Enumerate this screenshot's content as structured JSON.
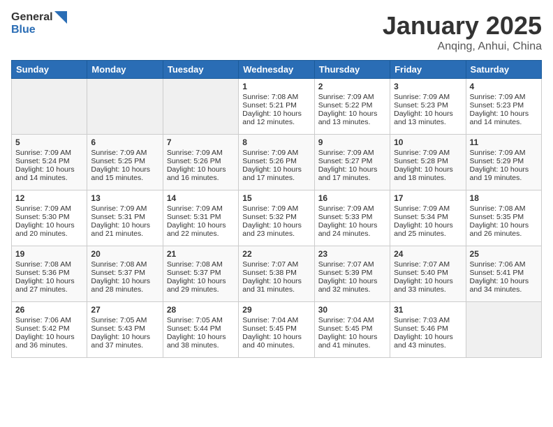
{
  "header": {
    "logo_general": "General",
    "logo_blue": "Blue",
    "month": "January 2025",
    "location": "Anqing, Anhui, China"
  },
  "days_of_week": [
    "Sunday",
    "Monday",
    "Tuesday",
    "Wednesday",
    "Thursday",
    "Friday",
    "Saturday"
  ],
  "weeks": [
    [
      {
        "day": "",
        "text": ""
      },
      {
        "day": "",
        "text": ""
      },
      {
        "day": "",
        "text": ""
      },
      {
        "day": "1",
        "text": "Sunrise: 7:08 AM\nSunset: 5:21 PM\nDaylight: 10 hours\nand 12 minutes."
      },
      {
        "day": "2",
        "text": "Sunrise: 7:09 AM\nSunset: 5:22 PM\nDaylight: 10 hours\nand 13 minutes."
      },
      {
        "day": "3",
        "text": "Sunrise: 7:09 AM\nSunset: 5:23 PM\nDaylight: 10 hours\nand 13 minutes."
      },
      {
        "day": "4",
        "text": "Sunrise: 7:09 AM\nSunset: 5:23 PM\nDaylight: 10 hours\nand 14 minutes."
      }
    ],
    [
      {
        "day": "5",
        "text": "Sunrise: 7:09 AM\nSunset: 5:24 PM\nDaylight: 10 hours\nand 14 minutes."
      },
      {
        "day": "6",
        "text": "Sunrise: 7:09 AM\nSunset: 5:25 PM\nDaylight: 10 hours\nand 15 minutes."
      },
      {
        "day": "7",
        "text": "Sunrise: 7:09 AM\nSunset: 5:26 PM\nDaylight: 10 hours\nand 16 minutes."
      },
      {
        "day": "8",
        "text": "Sunrise: 7:09 AM\nSunset: 5:26 PM\nDaylight: 10 hours\nand 17 minutes."
      },
      {
        "day": "9",
        "text": "Sunrise: 7:09 AM\nSunset: 5:27 PM\nDaylight: 10 hours\nand 17 minutes."
      },
      {
        "day": "10",
        "text": "Sunrise: 7:09 AM\nSunset: 5:28 PM\nDaylight: 10 hours\nand 18 minutes."
      },
      {
        "day": "11",
        "text": "Sunrise: 7:09 AM\nSunset: 5:29 PM\nDaylight: 10 hours\nand 19 minutes."
      }
    ],
    [
      {
        "day": "12",
        "text": "Sunrise: 7:09 AM\nSunset: 5:30 PM\nDaylight: 10 hours\nand 20 minutes."
      },
      {
        "day": "13",
        "text": "Sunrise: 7:09 AM\nSunset: 5:31 PM\nDaylight: 10 hours\nand 21 minutes."
      },
      {
        "day": "14",
        "text": "Sunrise: 7:09 AM\nSunset: 5:31 PM\nDaylight: 10 hours\nand 22 minutes."
      },
      {
        "day": "15",
        "text": "Sunrise: 7:09 AM\nSunset: 5:32 PM\nDaylight: 10 hours\nand 23 minutes."
      },
      {
        "day": "16",
        "text": "Sunrise: 7:09 AM\nSunset: 5:33 PM\nDaylight: 10 hours\nand 24 minutes."
      },
      {
        "day": "17",
        "text": "Sunrise: 7:09 AM\nSunset: 5:34 PM\nDaylight: 10 hours\nand 25 minutes."
      },
      {
        "day": "18",
        "text": "Sunrise: 7:08 AM\nSunset: 5:35 PM\nDaylight: 10 hours\nand 26 minutes."
      }
    ],
    [
      {
        "day": "19",
        "text": "Sunrise: 7:08 AM\nSunset: 5:36 PM\nDaylight: 10 hours\nand 27 minutes."
      },
      {
        "day": "20",
        "text": "Sunrise: 7:08 AM\nSunset: 5:37 PM\nDaylight: 10 hours\nand 28 minutes."
      },
      {
        "day": "21",
        "text": "Sunrise: 7:08 AM\nSunset: 5:37 PM\nDaylight: 10 hours\nand 29 minutes."
      },
      {
        "day": "22",
        "text": "Sunrise: 7:07 AM\nSunset: 5:38 PM\nDaylight: 10 hours\nand 31 minutes."
      },
      {
        "day": "23",
        "text": "Sunrise: 7:07 AM\nSunset: 5:39 PM\nDaylight: 10 hours\nand 32 minutes."
      },
      {
        "day": "24",
        "text": "Sunrise: 7:07 AM\nSunset: 5:40 PM\nDaylight: 10 hours\nand 33 minutes."
      },
      {
        "day": "25",
        "text": "Sunrise: 7:06 AM\nSunset: 5:41 PM\nDaylight: 10 hours\nand 34 minutes."
      }
    ],
    [
      {
        "day": "26",
        "text": "Sunrise: 7:06 AM\nSunset: 5:42 PM\nDaylight: 10 hours\nand 36 minutes."
      },
      {
        "day": "27",
        "text": "Sunrise: 7:05 AM\nSunset: 5:43 PM\nDaylight: 10 hours\nand 37 minutes."
      },
      {
        "day": "28",
        "text": "Sunrise: 7:05 AM\nSunset: 5:44 PM\nDaylight: 10 hours\nand 38 minutes."
      },
      {
        "day": "29",
        "text": "Sunrise: 7:04 AM\nSunset: 5:45 PM\nDaylight: 10 hours\nand 40 minutes."
      },
      {
        "day": "30",
        "text": "Sunrise: 7:04 AM\nSunset: 5:45 PM\nDaylight: 10 hours\nand 41 minutes."
      },
      {
        "day": "31",
        "text": "Sunrise: 7:03 AM\nSunset: 5:46 PM\nDaylight: 10 hours\nand 43 minutes."
      },
      {
        "day": "",
        "text": ""
      }
    ]
  ]
}
